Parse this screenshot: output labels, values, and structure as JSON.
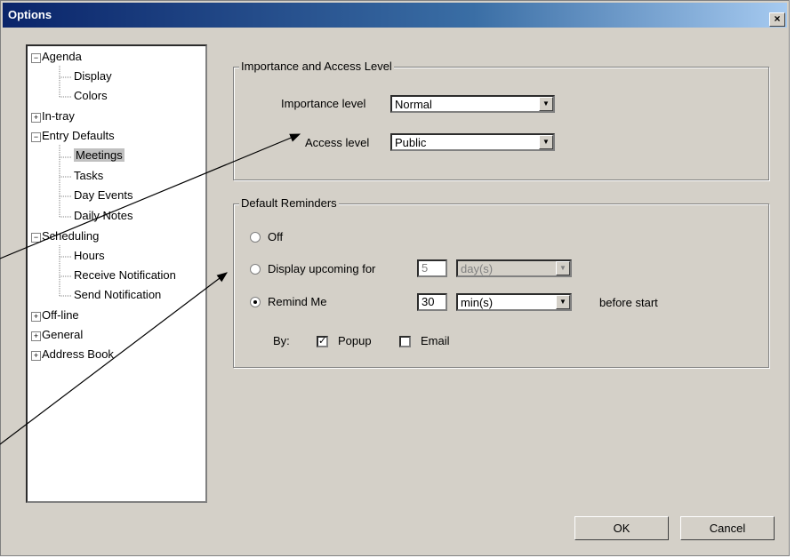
{
  "window": {
    "title": "Options",
    "close_label": "×"
  },
  "tree": {
    "items": [
      {
        "label": "Agenda",
        "expander": "−"
      },
      {
        "label": "Display"
      },
      {
        "label": "Colors"
      },
      {
        "label": "In-tray",
        "expander": "+"
      },
      {
        "label": "Entry Defaults",
        "expander": "−"
      },
      {
        "label": "Meetings",
        "selected": true
      },
      {
        "label": "Tasks"
      },
      {
        "label": "Day Events"
      },
      {
        "label": "Daily Notes"
      },
      {
        "label": "Scheduling",
        "expander": "−"
      },
      {
        "label": "Hours"
      },
      {
        "label": "Receive Notification"
      },
      {
        "label": "Send Notification"
      },
      {
        "label": "Off-line",
        "expander": "+"
      },
      {
        "label": "General",
        "expander": "+"
      },
      {
        "label": "Address Book",
        "expander": "+"
      }
    ]
  },
  "importance_group": {
    "title": "Importance and Access Level",
    "importance_label": "Importance level",
    "importance_value": "Normal",
    "access_label": "Access level",
    "access_value": "Public"
  },
  "reminders_group": {
    "title": "Default Reminders",
    "off_label": "Off",
    "display_label": "Display upcoming for",
    "display_value": "5",
    "display_unit": "day(s)",
    "remind_label": "Remind Me",
    "remind_value": "30",
    "remind_unit": "min(s)",
    "before_label": "before start",
    "by_label": "By:",
    "popup_label": "Popup",
    "email_label": "Email",
    "selected_option": "Remind Me",
    "popup_checked": true,
    "email_checked": false
  },
  "buttons": {
    "ok": "OK",
    "cancel": "Cancel"
  },
  "colors": {
    "title_start": "#0a246a",
    "title_end": "#a6caf0",
    "face": "#d4d0c8"
  }
}
